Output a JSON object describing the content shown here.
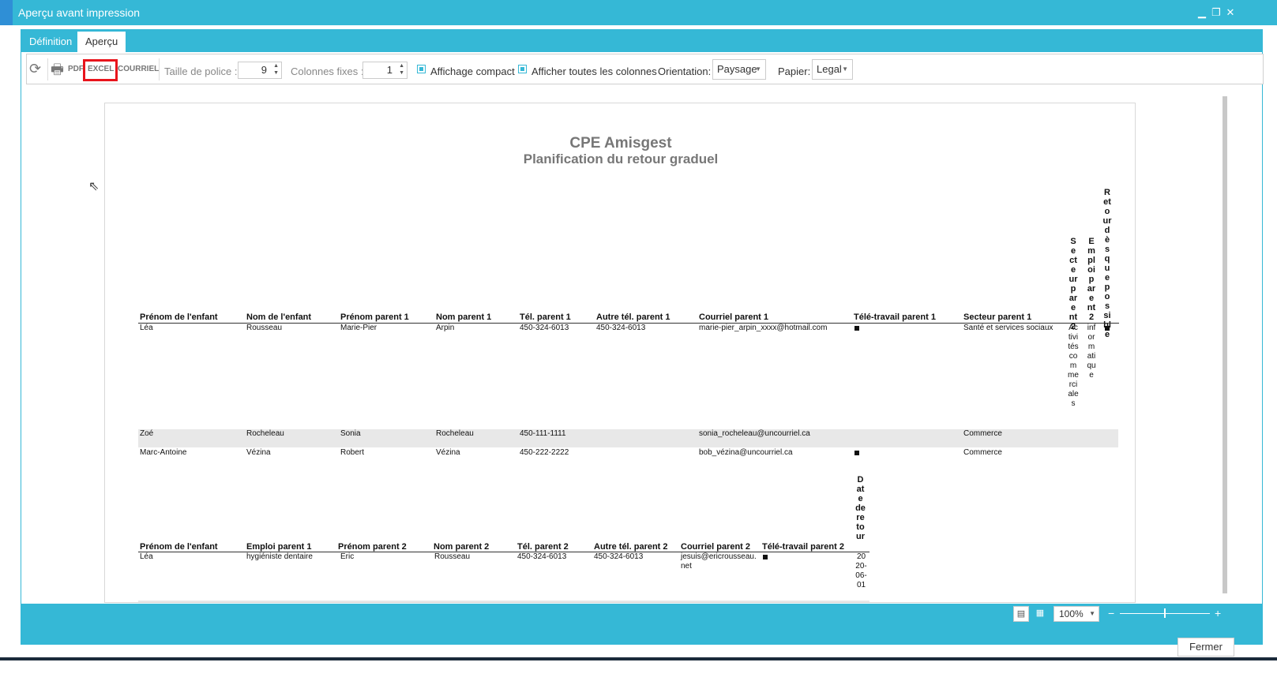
{
  "window": {
    "title": "Aperçu avant impression",
    "minimize": "▁",
    "restore": "❐",
    "close": "✕"
  },
  "tabs": [
    {
      "label": "Définition"
    },
    {
      "label": "Aperçu"
    }
  ],
  "toolbar": {
    "refresh_icon": "refresh-icon",
    "print_icon": "printer-icon",
    "pdf": "PDF",
    "excel": "EXCEL",
    "courriel": "COURRIEL",
    "font_size_label": "Taille de police :",
    "font_size_value": "9",
    "fixed_cols_label": "Colonnes fixes :",
    "fixed_cols_value": "1",
    "compact_label": "Affichage compact",
    "compact_checked": true,
    "all_cols_label": "Afficher toutes les colonnes",
    "all_cols_checked": true,
    "orientation_label": "Orientation:",
    "orientation_value": "Paysage",
    "paper_label": "Papier:",
    "paper_value": "Legal"
  },
  "report": {
    "title": "CPE Amisgest",
    "subtitle": "Planification du retour graduel",
    "table1": {
      "headers": [
        "Prénom de l'enfant",
        "Nom de l'enfant",
        "Prénom parent 1",
        "Nom parent 1",
        "Tél. parent 1",
        "Autre tél. parent 1",
        "Courriel parent 1",
        "Télé-travail parent 1",
        "Secteur parent 1"
      ],
      "vertical_headers": [
        "Secteur parent 2",
        "Emploi parent 2",
        "Retour dès que possible"
      ],
      "rows": [
        {
          "cells": [
            "Léa",
            "Rousseau",
            "Marie-Pier",
            "Arpin",
            "450-324-6013",
            "450-324-6013",
            "marie-pier_arpin_xxxx@hotmail.com",
            "",
            "Santé et services sociaux"
          ],
          "telework": true,
          "secteur2": "Activités commerciales",
          "emploi2": "informatique",
          "retour": true
        },
        {
          "cells": [
            "Zoé",
            "Rocheleau",
            "Sonia",
            "Rocheleau",
            "450-111-1111",
            "",
            "sonia_rocheleau@uncourriel.ca",
            "",
            "Commerce"
          ],
          "telework": false
        },
        {
          "cells": [
            "Marc-Antoine",
            "Vézina",
            "Robert",
            "Vézina",
            "450-222-2222",
            "",
            "bob_vézina@uncourriel.ca",
            "",
            "Commerce"
          ],
          "telework": true
        }
      ]
    },
    "table2": {
      "headers": [
        "Prénom de l'enfant",
        "Emploi parent 1",
        "Prénom parent 2",
        "Nom parent 2",
        "Tél. parent 2",
        "Autre tél. parent 2",
        "Courriel parent 2",
        "Télé-travail parent 2"
      ],
      "vertical_header": "Date de retour",
      "rows": [
        {
          "cells": [
            "Léa",
            "hygiéniste dentaire",
            "Eric",
            "Rousseau",
            "450-324-6013",
            "450-324-6013",
            "jesuis@ericrousseau.net",
            ""
          ],
          "telework": true,
          "date": "2020-06-01"
        }
      ]
    }
  },
  "status": {
    "zoom": "100%",
    "zoom_minus": "−",
    "zoom_plus": "+"
  },
  "footer": {
    "close": "Fermer"
  },
  "colors": {
    "accent": "#35b8d6",
    "highlight": "#e8141c"
  }
}
